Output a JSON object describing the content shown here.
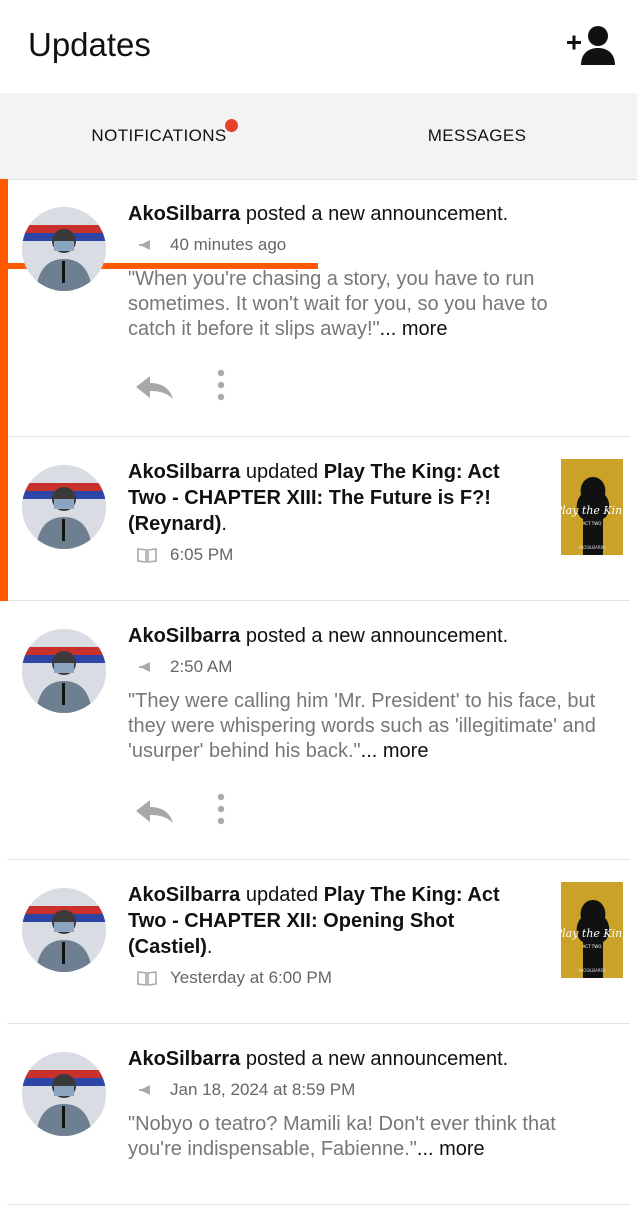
{
  "header": {
    "title": "Updates"
  },
  "tabs": {
    "notifications": "NOTIFICATIONS",
    "messages": "MESSAGES"
  },
  "colors": {
    "accent": "#ff5a00",
    "badge": "#e8412a"
  },
  "items": [
    {
      "user": "AkoSilbarra",
      "action": " posted a new announcement.",
      "time": "40 minutes ago",
      "quote": "\"When you're chasing a story, you have to run sometimes. It won't wait for you, so you have to catch it before it slips away!\"",
      "more": "... more"
    },
    {
      "user": "AkoSilbarra",
      "action": " updated ",
      "story": "Play The King: Act Two - CHAPTER XIII: The Future is F?! (Reynard)",
      "tail": ".",
      "time": "6:05 PM",
      "cover_title": "Play the King",
      "cover_sub": "ACT TWO",
      "cover_author": "AKOSILBARRA"
    },
    {
      "user": "AkoSilbarra",
      "action": " posted a new announcement.",
      "time": "2:50 AM",
      "quote": "\"They were calling him 'Mr. President' to his face, but they were whispering words such as 'illegitimate' and 'usurper' behind his back.\"",
      "more": "... more"
    },
    {
      "user": "AkoSilbarra",
      "action": " updated ",
      "story": "Play The King: Act Two - CHAPTER XII: Opening Shot (Castiel)",
      "tail": ".",
      "time": "Yesterday at 6:00 PM",
      "cover_title": "Play the King",
      "cover_sub": "ACT TWO",
      "cover_author": "AKOSILBARRA"
    },
    {
      "user": "AkoSilbarra",
      "action": " posted a new announcement.",
      "time": "Jan 18, 2024 at 8:59 PM",
      "quote": "\"Nobyo o teatro? Mamili ka! Don't ever think that you're indispensable, Fabienne.\"",
      "more": "... more"
    }
  ]
}
